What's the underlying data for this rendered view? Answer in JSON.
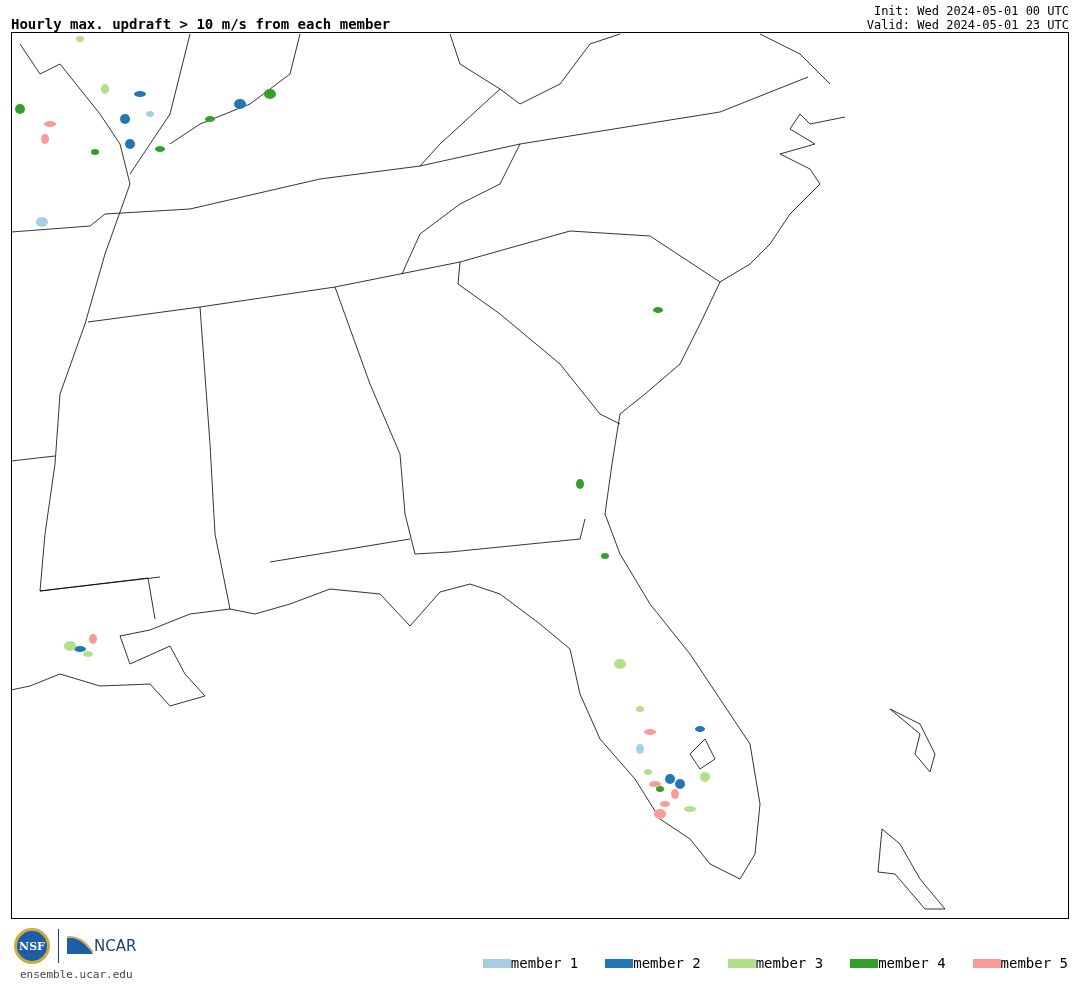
{
  "title": "Hourly max. updraft > 10 m/s from each member",
  "init": "Init: Wed 2024-05-01 00 UTC",
  "valid": "Valid: Wed 2024-05-01 23 UTC",
  "logos": {
    "nsf": "NSF",
    "ncar": "NCAR"
  },
  "site": "ensemble.ucar.edu",
  "legend": [
    {
      "label": "member 1",
      "color": "#a6cee3"
    },
    {
      "label": "member 2",
      "color": "#1f78b4"
    },
    {
      "label": "member 3",
      "color": "#b2df8a"
    },
    {
      "label": "member 4",
      "color": "#33a02c"
    },
    {
      "label": "member 5",
      "color": "#fb9a99"
    }
  ]
}
